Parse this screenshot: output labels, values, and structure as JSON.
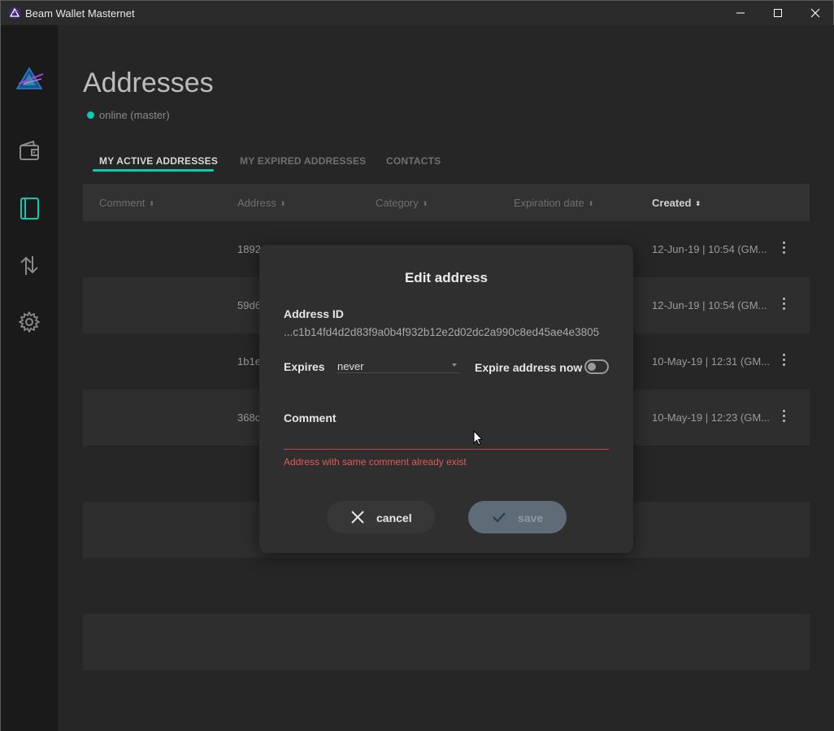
{
  "window": {
    "title": "Beam Wallet Masternet"
  },
  "sidebar": {
    "items": [
      {
        "name": "wallet",
        "icon": "wallet-icon"
      },
      {
        "name": "addresses",
        "icon": "address-book-icon",
        "active": true
      },
      {
        "name": "utxo",
        "icon": "transfer-arrows-icon"
      },
      {
        "name": "settings",
        "icon": "gear-icon"
      }
    ]
  },
  "page": {
    "title": "Addresses",
    "status": "online (master)"
  },
  "tabs": [
    "MY ACTIVE ADDRESSES",
    "MY EXPIRED ADDRESSES",
    "CONTACTS"
  ],
  "table": {
    "headers": [
      "Comment",
      "Address",
      "Category",
      "Expiration date",
      "Created"
    ],
    "rows": [
      {
        "address": "1892",
        "created": "12-Jun-19 | 10:54 (GM..."
      },
      {
        "address": "59d6",
        "created": "12-Jun-19 | 10:54 (GM..."
      },
      {
        "address": "1b1e",
        "created": "10-May-19 | 12:31 (GM..."
      },
      {
        "address": "368c",
        "created": "10-May-19 | 12:23 (GM..."
      }
    ]
  },
  "modal": {
    "title": "Edit address",
    "address_id_label": "Address ID",
    "address_id": "...c1b14fd4d2d83f9a0b4f932b12e2d02dc2a990c8ed45ae4e3805",
    "expires_label": "Expires",
    "expires_value": "never",
    "expire_now_label": "Expire address now",
    "expire_now_on": false,
    "comment_label": "Comment",
    "comment_value": "",
    "error": "Address with same comment already exist",
    "cancel_label": "cancel",
    "save_label": "save"
  },
  "colors": {
    "accent": "#0bccb1",
    "error": "#e05a5a",
    "save_disabled": "#5f6c77"
  }
}
